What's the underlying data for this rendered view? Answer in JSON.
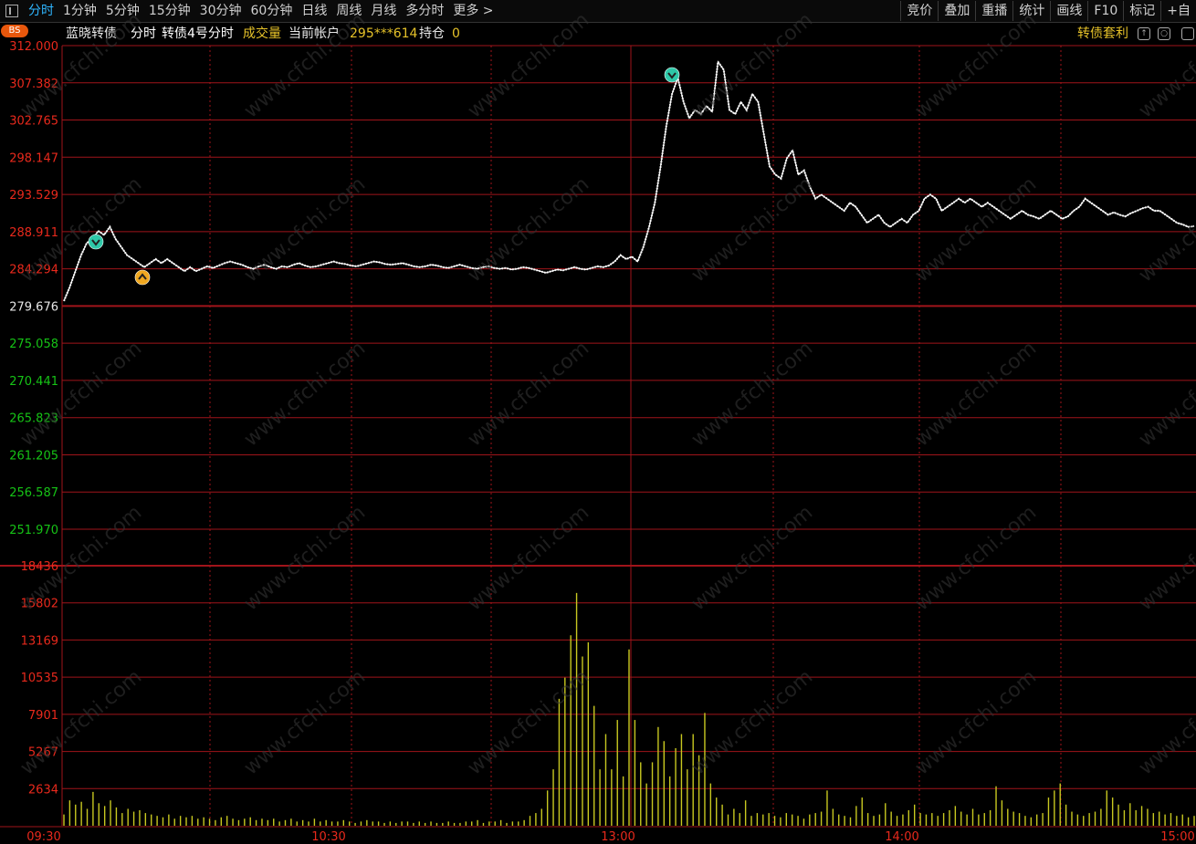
{
  "toolbar": {
    "periods": [
      "分时",
      "1分钟",
      "5分钟",
      "15分钟",
      "30分钟",
      "60分钟",
      "日线",
      "周线",
      "月线",
      "多分时",
      "更多 >"
    ],
    "active_period": "分时",
    "buttons": [
      "竞价",
      "叠加",
      "重播",
      "统计",
      "画线",
      "F10",
      "标记",
      "+自"
    ]
  },
  "infobar": {
    "bs_badge": "BS",
    "name": "蓝晓转债",
    "mode": "分时",
    "index_label": "转债4号分时",
    "volume_label": "成交量",
    "account_label": "当前帐户",
    "account_value": "295***614",
    "position_label": "持仓",
    "position_value": "0",
    "arb_label": "转债套利"
  },
  "colors": {
    "up": "#e8291c",
    "down": "#16c316",
    "price_line": "#ffffff",
    "avg_line": "#dcdcdc",
    "volume": "#c8c820",
    "grid": "#a0141a",
    "active_tab": "#2fb6ff",
    "yellow_text": "#e6c229"
  },
  "chart_data": [
    {
      "type": "line",
      "title": "",
      "x_ticks": [
        "09:30",
        "10:30",
        "13:00",
        "14:00",
        "15:00"
      ],
      "y_ticks": [
        "312.000",
        "307.382",
        "302.765",
        "298.147",
        "293.529",
        "288.911",
        "284.294",
        "279.676",
        "275.058",
        "270.441",
        "265.823",
        "261.205",
        "256.587",
        "251.970"
      ],
      "ylim": [
        251.97,
        312.0
      ],
      "prev_close": 279.676,
      "grid": true,
      "series": [
        {
          "values": [
            280.3,
            282.0,
            284.0,
            286.0,
            287.5,
            288.0,
            289.0,
            288.5,
            289.5,
            288.0,
            287.0,
            286.0,
            285.5,
            285.0,
            284.5,
            285.0,
            285.5,
            285.0,
            285.5,
            285.0,
            284.5,
            284.0,
            284.5,
            284.0,
            284.3,
            284.6,
            284.4,
            284.7,
            285.0,
            285.2,
            285.0,
            284.8,
            284.5,
            284.3,
            284.6,
            284.8,
            284.5,
            284.3,
            284.6,
            284.5,
            284.8,
            285.0,
            284.7,
            284.5,
            284.6,
            284.8,
            285.0,
            285.2,
            285.0,
            284.9,
            284.7,
            284.6,
            284.8,
            285.0,
            285.2,
            285.1,
            284.9,
            284.8,
            284.9,
            285.0,
            284.8,
            284.6,
            284.5,
            284.6,
            284.8,
            284.7,
            284.5,
            284.4,
            284.6,
            284.8,
            284.6,
            284.4,
            284.3,
            284.5,
            284.6,
            284.4,
            284.3,
            284.4,
            284.2,
            284.3,
            284.5,
            284.4,
            284.2,
            284.0,
            283.8,
            284.0,
            284.2,
            284.1,
            284.3,
            284.5,
            284.3,
            284.2,
            284.4,
            284.6,
            284.5,
            284.7,
            285.2,
            286.0,
            285.5,
            285.8,
            285.2,
            287.0,
            289.5,
            292.5,
            297.0,
            302.0,
            306.0,
            308.0,
            305.0,
            303.0,
            304.0,
            303.5,
            304.5,
            303.8,
            310.0,
            309.0,
            304.0,
            303.5,
            305.0,
            304.0,
            306.0,
            305.0,
            301.0,
            297.0,
            296.0,
            295.5,
            298.0,
            299.0,
            296.0,
            296.5,
            294.5,
            293.0,
            293.5,
            293.0,
            292.5,
            292.0,
            291.5,
            292.5,
            292.0,
            291.0,
            290.0,
            290.5,
            291.0,
            290.0,
            289.5,
            290.0,
            290.5,
            290.0,
            291.0,
            291.5,
            293.0,
            293.5,
            293.0,
            291.5,
            292.0,
            292.5,
            293.0,
            292.5,
            293.0,
            292.5,
            292.0,
            292.5,
            292.0,
            291.5,
            291.0,
            290.5,
            291.0,
            291.5,
            291.0,
            290.8,
            290.5,
            291.0,
            291.5,
            291.0,
            290.5,
            290.8,
            291.5,
            292.0,
            293.0,
            292.5,
            292.0,
            291.5,
            291.0,
            291.3,
            291.0,
            290.8,
            291.2,
            291.5,
            291.8,
            292.0,
            291.5,
            291.5,
            291.0,
            290.5,
            290.0,
            289.8,
            289.5,
            289.6
          ]
        }
      ]
    },
    {
      "type": "bar",
      "title": "",
      "x_ticks": [
        "09:30",
        "10:30",
        "13:00",
        "14:00",
        "15:00"
      ],
      "y_ticks": [
        "18436",
        "15802",
        "13169",
        "10535",
        "7901",
        "5267",
        "2634"
      ],
      "ylim": [
        0,
        18436
      ],
      "grid": true,
      "series": [
        {
          "values": [
            800,
            1800,
            1500,
            1700,
            1200,
            2400,
            1600,
            1400,
            1800,
            1300,
            900,
            1200,
            1000,
            1100,
            900,
            800,
            700,
            600,
            800,
            500,
            700,
            600,
            700,
            500,
            600,
            500,
            400,
            600,
            700,
            500,
            400,
            500,
            600,
            400,
            500,
            400,
            500,
            300,
            400,
            500,
            300,
            400,
            300,
            500,
            300,
            400,
            300,
            300,
            400,
            300,
            200,
            300,
            400,
            300,
            300,
            200,
            300,
            200,
            300,
            300,
            200,
            300,
            200,
            300,
            200,
            200,
            300,
            200,
            200,
            300,
            300,
            400,
            200,
            300,
            300,
            400,
            200,
            300,
            300,
            400,
            700,
            900,
            1200,
            2500,
            4000,
            9000,
            10500,
            13500,
            16500,
            12000,
            13000,
            8500,
            4000,
            6500,
            4000,
            7500,
            3500,
            12500,
            7500,
            4500,
            3000,
            4500,
            7000,
            6000,
            3500,
            5500,
            6500,
            4000,
            6500,
            5000,
            8000,
            3000,
            2000,
            1500,
            800,
            1200,
            900,
            1800,
            700,
            900,
            800,
            900,
            700,
            600,
            900,
            800,
            700,
            500,
            800,
            900,
            1000,
            2500,
            1200,
            800,
            700,
            600,
            1400,
            2000,
            900,
            700,
            800,
            1600,
            1000,
            700,
            800,
            1100,
            1500,
            900,
            800,
            900,
            700,
            900,
            1100,
            1400,
            1000,
            800,
            1200,
            800,
            900,
            1100,
            2800,
            1800,
            1200,
            1000,
            900,
            700,
            600,
            800,
            900,
            2000,
            2500,
            3000,
            1500,
            1000,
            800,
            700,
            900,
            1000,
            1200,
            2500,
            2000,
            1500,
            1100,
            1600,
            1100,
            1400,
            1200,
            900,
            1000,
            800,
            900,
            700,
            800,
            600,
            700
          ]
        }
      ]
    }
  ]
}
